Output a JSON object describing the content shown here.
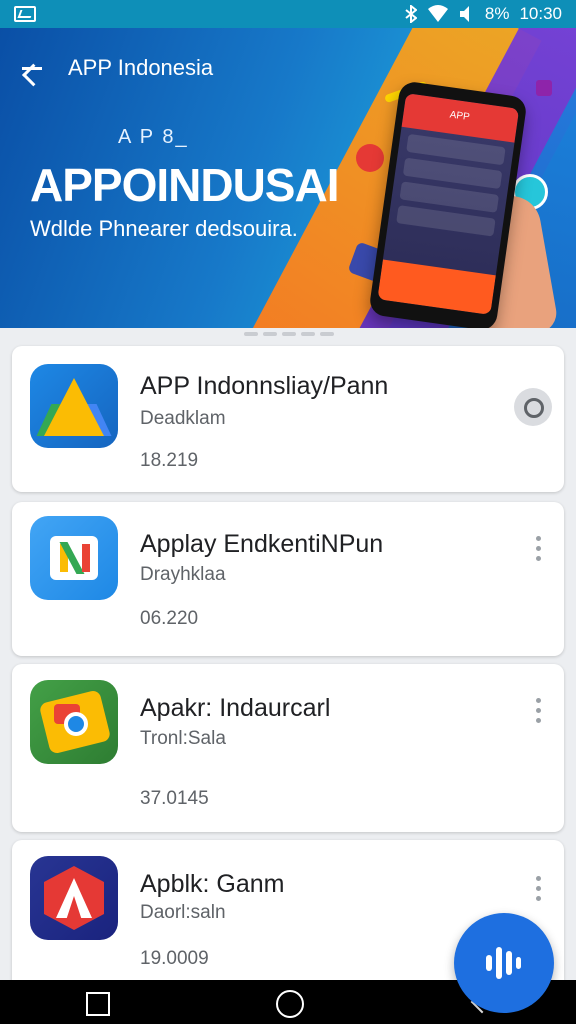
{
  "status_bar": {
    "battery": "8%",
    "time": "10:30",
    "icons": [
      "gallery-icon",
      "bluetooth-icon",
      "wifi-icon",
      "volume-icon"
    ]
  },
  "header": {
    "title": "APP Indonesia",
    "hero_small": "A P  8_",
    "hero_big": "APPOINDUSAI",
    "hero_sub": "Wdlde Phnearer dedsouira.",
    "phone_label": "APP"
  },
  "apps": [
    {
      "title": "APP Indonnsliay/Pann",
      "subtitle": "Deadklam",
      "meta": "18.219",
      "action": "round-button"
    },
    {
      "title": "Applay EndkentiNPun",
      "subtitle": "Drayhklaa",
      "meta": "06.220",
      "action": "menu"
    },
    {
      "title": "Apakr: Indaurcarl",
      "subtitle": "Tronl:Sala",
      "meta": "37.0145",
      "action": "menu"
    },
    {
      "title": "Apblk: Ganm",
      "subtitle": "Daorl:saln",
      "meta": "19.0009",
      "action": "menu"
    }
  ],
  "fab": {
    "icon": "audio-wave-icon"
  },
  "colors": {
    "accent": "#1e6fe0",
    "hero": "#1779c9",
    "status": "#0e8fb8"
  }
}
